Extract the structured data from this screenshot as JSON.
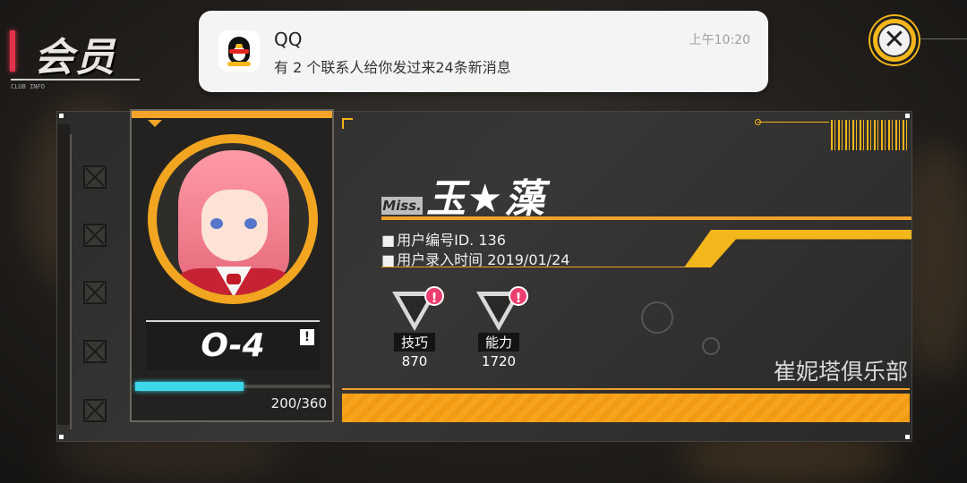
{
  "header": {
    "title": "会员",
    "subtitle": "CLUB INFO"
  },
  "notification": {
    "app": "QQ",
    "message": "有 2 个联系人给你发过来24条新消息",
    "time": "上午10:20",
    "icon": "qq-penguin-icon"
  },
  "close_button": {
    "icon": "close-icon",
    "glyph": "✕"
  },
  "profile": {
    "title": "Miss.",
    "name": "玉★藻",
    "user_id": "用户编号ID. 136",
    "join_date": "用户录入时间 2019/01/24",
    "rank": "O-4",
    "rank_alert": "!",
    "exp_text": "200/360",
    "exp_fraction": 0.555,
    "club": "崔妮塔俱乐部"
  },
  "stats": [
    {
      "label": "技巧",
      "value": "870",
      "badge": "!"
    },
    {
      "label": "能力",
      "value": "1720",
      "badge": "!"
    }
  ],
  "colors": {
    "accent": "#f3b61b",
    "orange": "#f0a22a",
    "exp": "#3cd8ea",
    "badge": "#ec3e6e",
    "header_mark": "#e0324a"
  }
}
